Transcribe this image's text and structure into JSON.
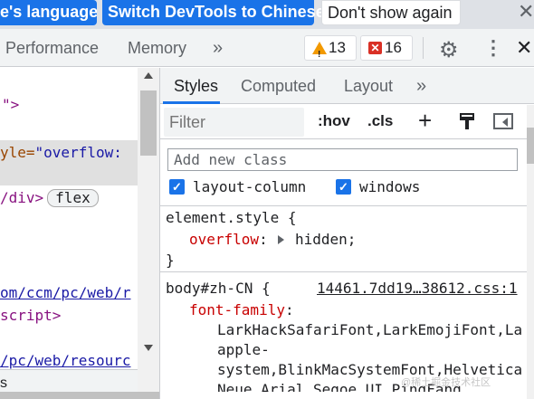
{
  "language_bar": {
    "partial_button": "e's language",
    "switch_button": "Switch DevTools to Chinese",
    "dont_show_button": "Don't show again",
    "close_label": "✕"
  },
  "toolbar": {
    "tabs": [
      "Performance",
      "Memory"
    ],
    "more_tabs": "»",
    "warnings_count": "13",
    "errors_count": "16",
    "gear": "⚙",
    "more": "⋮",
    "close": "✕"
  },
  "elements": {
    "line1": "\">",
    "line2_attr": "yle=",
    "line2_val": "\"overflow:",
    "line3_tag": "/div>",
    "line3_badge": "flex",
    "line4_link": "om/ccm/pc/web/r",
    "line5_tag": "script>",
    "line6_link": "/pc/web/resourc",
    "bottom_text": "s"
  },
  "styles": {
    "tabs": [
      "Styles",
      "Computed",
      "Layout"
    ],
    "more_tabs": "»",
    "filter_placeholder": "Filter",
    "hov": ":hov",
    "cls": ".cls",
    "plus": "+",
    "add_class_placeholder": "Add new class",
    "classes": [
      "layout-column",
      "windows"
    ],
    "rule1": {
      "selector": "element.style {",
      "property": "overflow",
      "value": "hidden;",
      "close": "}"
    },
    "rule2": {
      "selector": "body#zh-CN {",
      "source": "14461.7dd19…38612.css:1",
      "property": "font-family",
      "value_lines": [
        "LarkHackSafariFont,LarkEmojiFont,La",
        "apple-",
        "system,BlinkMacSystemFont,Helvetica",
        "Neue,Arial,Segoe UI,PingFang"
      ]
    }
  },
  "watermark": "@稀土掘金技术社区"
}
